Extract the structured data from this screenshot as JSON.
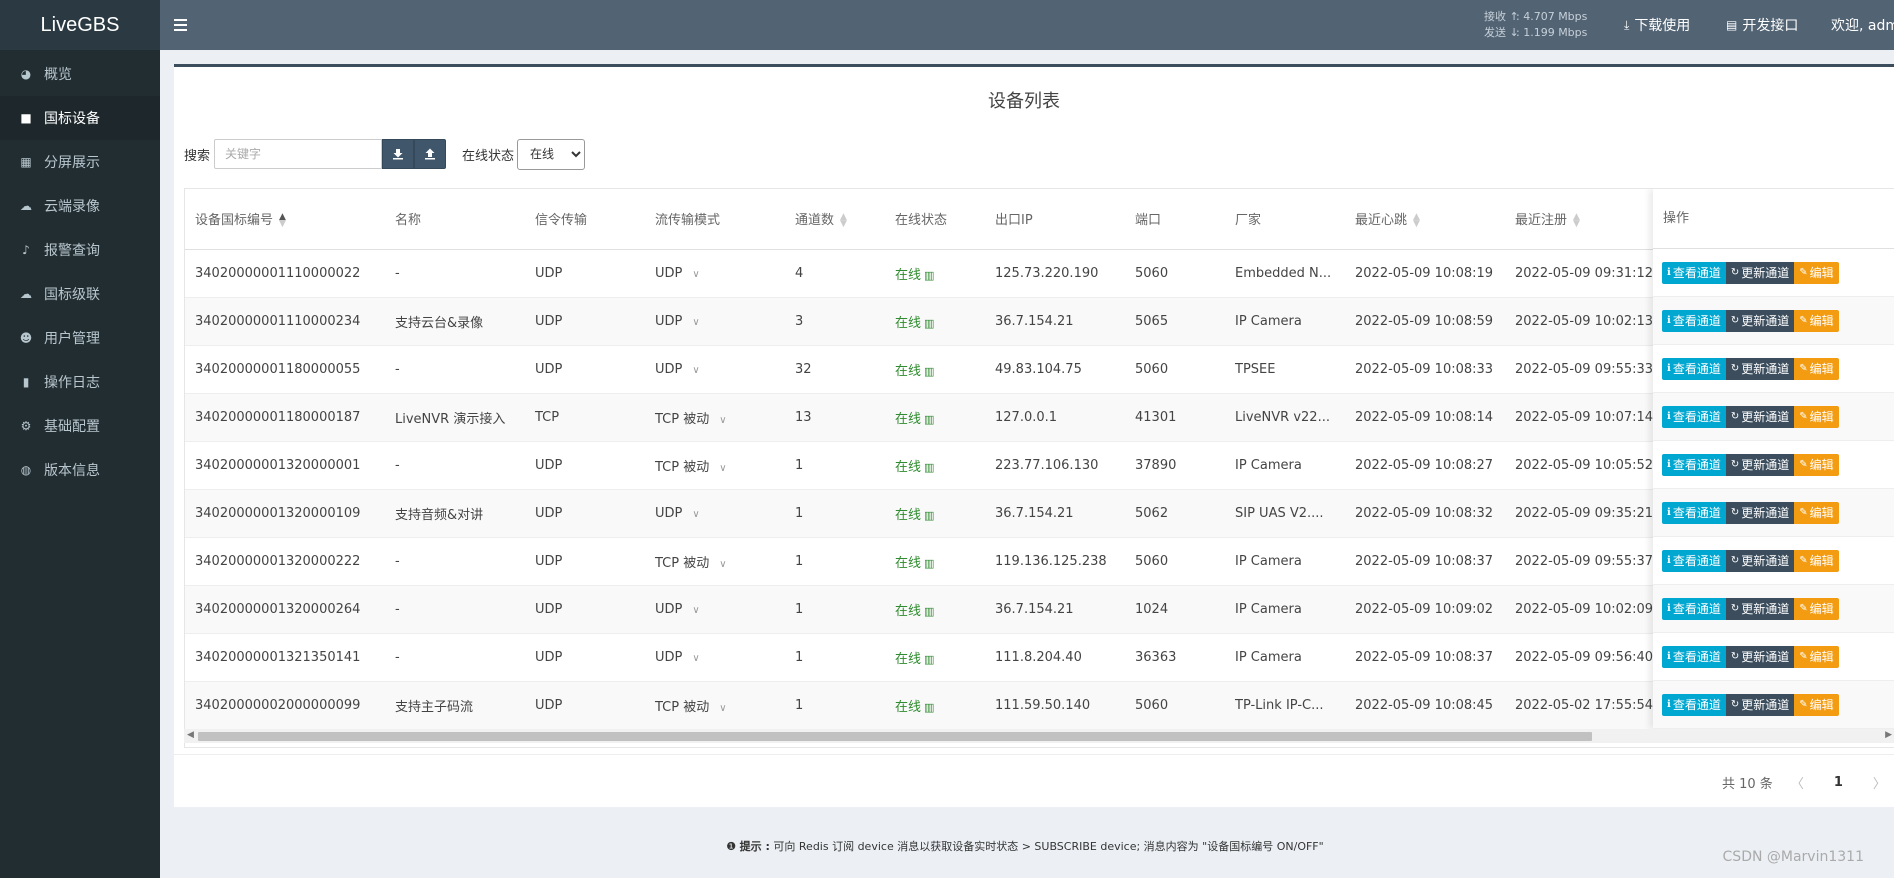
{
  "app": {
    "logo": "LiveGBS"
  },
  "sidebar": {
    "items": [
      {
        "label": "概览",
        "icon": "dashboard-icon",
        "glyph": "◕"
      },
      {
        "label": "国标设备",
        "icon": "video-camera-icon",
        "glyph": "■",
        "active": true
      },
      {
        "label": "分屏展示",
        "icon": "grid-icon",
        "glyph": "▦"
      },
      {
        "label": "云端录像",
        "icon": "cloud-icon",
        "glyph": "☁"
      },
      {
        "label": "报警查询",
        "icon": "bell-icon",
        "glyph": "♪"
      },
      {
        "label": "国标级联",
        "icon": "cloud-upload-icon",
        "glyph": "☁"
      },
      {
        "label": "用户管理",
        "icon": "users-icon",
        "glyph": "☻"
      },
      {
        "label": "操作日志",
        "icon": "file-icon",
        "glyph": "▮"
      },
      {
        "label": "基础配置",
        "icon": "cogs-icon",
        "glyph": "⚙"
      },
      {
        "label": "版本信息",
        "icon": "globe-icon",
        "glyph": "◍"
      }
    ]
  },
  "header": {
    "net": {
      "recv_label": "接收 ↑",
      "recv_value": ": 4.707 Mbps",
      "send_label": "发送 ↓",
      "send_value": ": 1.199 Mbps"
    },
    "download": "下载使用",
    "api": "开发接口",
    "welcome": "欢迎, adm"
  },
  "page": {
    "title": "设备列表",
    "search_label": "搜索",
    "search_placeholder": "关键字",
    "status_label": "在线状态",
    "status_selected": "在线"
  },
  "table": {
    "headers": {
      "id": "设备国标编号",
      "name": "名称",
      "signal": "信令传输",
      "stream": "流传输模式",
      "channels": "通道数",
      "status": "在线状态",
      "ip": "出口IP",
      "port": "端口",
      "vendor": "厂家",
      "heartbeat": "最近心跳",
      "register": "最近注册",
      "ops": "操作"
    },
    "rows": [
      {
        "id": "34020000001110000022",
        "name": "-",
        "signal": "UDP",
        "stream": "UDP",
        "channels": "4",
        "status": "在线",
        "ip": "125.73.220.190",
        "port": "5060",
        "vendor": "Embedded N...",
        "heartbeat": "2022-05-09 10:08:19",
        "register": "2022-05-09 09:31:12"
      },
      {
        "id": "34020000001110000234",
        "name": "支持云台&录像",
        "signal": "UDP",
        "stream": "UDP",
        "channels": "3",
        "status": "在线",
        "ip": "36.7.154.21",
        "port": "5065",
        "vendor": "IP Camera",
        "heartbeat": "2022-05-09 10:08:59",
        "register": "2022-05-09 10:02:13"
      },
      {
        "id": "34020000001180000055",
        "name": "-",
        "signal": "UDP",
        "stream": "UDP",
        "channels": "32",
        "status": "在线",
        "ip": "49.83.104.75",
        "port": "5060",
        "vendor": "TPSEE",
        "heartbeat": "2022-05-09 10:08:33",
        "register": "2022-05-09 09:55:33"
      },
      {
        "id": "34020000001180000187",
        "name": "LiveNVR 演示接入",
        "signal": "TCP",
        "stream": "TCP 被动",
        "channels": "13",
        "status": "在线",
        "ip": "127.0.0.1",
        "port": "41301",
        "vendor": "LiveNVR v22...",
        "heartbeat": "2022-05-09 10:08:14",
        "register": "2022-05-09 10:07:14"
      },
      {
        "id": "34020000001320000001",
        "name": "-",
        "signal": "UDP",
        "stream": "TCP 被动",
        "channels": "1",
        "status": "在线",
        "ip": "223.77.106.130",
        "port": "37890",
        "vendor": "IP Camera",
        "heartbeat": "2022-05-09 10:08:27",
        "register": "2022-05-09 10:05:52"
      },
      {
        "id": "34020000001320000109",
        "name": "支持音频&对讲",
        "signal": "UDP",
        "stream": "UDP",
        "channels": "1",
        "status": "在线",
        "ip": "36.7.154.21",
        "port": "5062",
        "vendor": "SIP UAS V2....",
        "heartbeat": "2022-05-09 10:08:32",
        "register": "2022-05-09 09:35:21"
      },
      {
        "id": "34020000001320000222",
        "name": "-",
        "signal": "UDP",
        "stream": "TCP 被动",
        "channels": "1",
        "status": "在线",
        "ip": "119.136.125.238",
        "port": "5060",
        "vendor": "IP Camera",
        "heartbeat": "2022-05-09 10:08:37",
        "register": "2022-05-09 09:55:37"
      },
      {
        "id": "34020000001320000264",
        "name": "-",
        "signal": "UDP",
        "stream": "UDP",
        "channels": "1",
        "status": "在线",
        "ip": "36.7.154.21",
        "port": "1024",
        "vendor": "IP Camera",
        "heartbeat": "2022-05-09 10:09:02",
        "register": "2022-05-09 10:02:09"
      },
      {
        "id": "34020000001321350141",
        "name": "-",
        "signal": "UDP",
        "stream": "UDP",
        "channels": "1",
        "status": "在线",
        "ip": "111.8.204.40",
        "port": "36363",
        "vendor": "IP Camera",
        "heartbeat": "2022-05-09 10:08:37",
        "register": "2022-05-09 09:56:40"
      },
      {
        "id": "34020000002000000099",
        "name": "支持主子码流",
        "signal": "UDP",
        "stream": "TCP 被动",
        "channels": "1",
        "status": "在线",
        "ip": "111.59.50.140",
        "port": "5060",
        "vendor": "TP-Link IP-C...",
        "heartbeat": "2022-05-09 10:08:45",
        "register": "2022-05-02 17:55:54"
      }
    ],
    "actions": {
      "view": "查看通道",
      "update": "更新通道",
      "edit": "编辑"
    }
  },
  "pager": {
    "total": "共 10 条",
    "current": "1"
  },
  "footer": {
    "tip_prefix": "提示 :",
    "tip": " 可向 Redis 订阅 device 消息以获取设备实时状态 > SUBSCRIBE device; 消息内容为 \"设备国标编号 ON/OFF\""
  },
  "watermark": "CSDN @Marvin1311",
  "colors": {
    "sidebar": "#222d32",
    "header": "#526374",
    "view_btn": "#00a7d0",
    "update_btn": "#3c4e5e",
    "edit_btn": "#f39c12",
    "online": "#2e8b2e"
  }
}
